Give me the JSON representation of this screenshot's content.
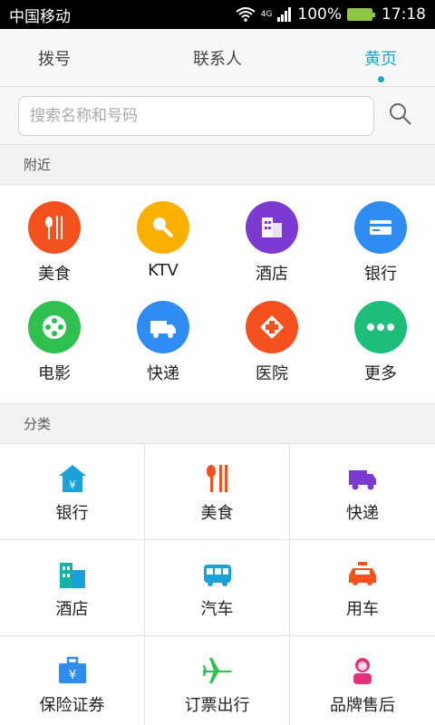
{
  "statusbar": {
    "carrier": "中国移动",
    "network": "4G",
    "battery": "100%",
    "time": "17:18"
  },
  "tabs": [
    {
      "label": "拨号"
    },
    {
      "label": "联系人"
    },
    {
      "label": "黄页",
      "active": true
    }
  ],
  "search": {
    "placeholder": "搜索名称和号码"
  },
  "sections": {
    "nearby": "附近",
    "category": "分类"
  },
  "nearby_items": [
    {
      "label": "美食",
      "icon": "fork-knife-icon",
      "color": "#f4511e"
    },
    {
      "label": "KTV",
      "icon": "microphone-icon",
      "color": "#f9b000"
    },
    {
      "label": "酒店",
      "icon": "hotel-building-icon",
      "color": "#7c3ad3"
    },
    {
      "label": "银行",
      "icon": "bank-card-icon",
      "color": "#2f8cf2"
    },
    {
      "label": "电影",
      "icon": "film-reel-icon",
      "color": "#2fc04f"
    },
    {
      "label": "快递",
      "icon": "delivery-truck-icon",
      "color": "#2f8cf2"
    },
    {
      "label": "医院",
      "icon": "hospital-cross-icon",
      "color": "#f4511e"
    },
    {
      "label": "更多",
      "icon": "more-dots-icon",
      "color": "#1dbd7a"
    }
  ],
  "categories": [
    {
      "label": "银行",
      "icon": "bank-house-icon",
      "color": "#1aa1d8"
    },
    {
      "label": "美食",
      "icon": "fork-knife-icon",
      "color": "#f4511e"
    },
    {
      "label": "快递",
      "icon": "delivery-truck-icon",
      "color": "#7c3ad3"
    },
    {
      "label": "酒店",
      "icon": "hotel-building-icon",
      "color": "#14b3a8"
    },
    {
      "label": "汽车",
      "icon": "bus-icon",
      "color": "#1aa1d8"
    },
    {
      "label": "用车",
      "icon": "taxi-icon",
      "color": "#f4511e"
    },
    {
      "label": "保险证券",
      "icon": "briefcase-yuan-icon",
      "color": "#2f8cf2"
    },
    {
      "label": "订票出行",
      "icon": "airplane-icon",
      "color": "#2fc04f"
    },
    {
      "label": "品牌售后",
      "icon": "support-agent-icon",
      "color": "#e2337a"
    }
  ]
}
